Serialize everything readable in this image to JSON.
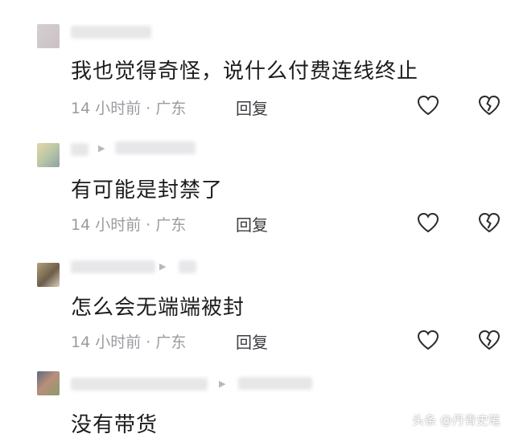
{
  "comments": [
    {
      "text": "我也觉得奇怪，说什么付费连线终止",
      "time": "14 小时前 · 广东",
      "reply_label": "回复"
    },
    {
      "text": "有可能是封禁了",
      "time": "14 小时前 · 广东",
      "reply_label": "回复"
    },
    {
      "text": "怎么会无端端被封",
      "time": "14 小时前 · 广东",
      "reply_label": "回复"
    },
    {
      "text": "没有带货"
    }
  ],
  "watermark": "头条 @丹青史笔",
  "icons": {
    "like": "heart-outline-icon",
    "dislike": "broken-heart-icon",
    "reply_arrow": "triangle-right-icon"
  },
  "colors": {
    "text": "#1c1c1e",
    "meta": "#9a9aa0",
    "reply": "#3b3b40"
  }
}
